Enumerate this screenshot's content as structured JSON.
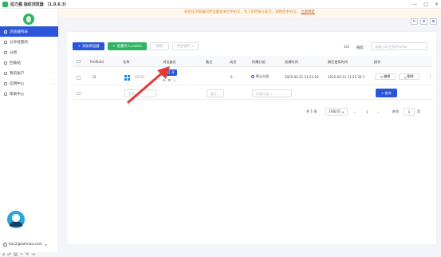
{
  "app": {
    "title": "拉力猫 指纹浏览器 （1.0.6.3）",
    "brand_name": "拉力猫"
  },
  "window_controls": [
    "—",
    "□",
    "✕"
  ],
  "notice": {
    "text": "初始化浏览器同步设置会清空手机号，为了您的账号安全，请绑定手机号。",
    "link": "立即绑定"
  },
  "top_icons": [
    {
      "icon": "refresh-icon",
      "glyph": "↻"
    },
    {
      "icon": "settings-icon",
      "glyph": "⚙"
    },
    {
      "icon": "expand-icon",
      "glyph": "⊞"
    }
  ],
  "sidebar": {
    "items": [
      {
        "label": "浏览器列表",
        "icon": "list-icon",
        "active": true
      },
      {
        "label": "分享给我的",
        "icon": "share-icon"
      },
      {
        "label": "分组",
        "icon": "group-icon"
      },
      {
        "label": "回收站",
        "icon": "trash-icon"
      },
      {
        "label": "我的账户",
        "icon": "account-icon",
        "arrow": "›"
      },
      {
        "label": "应用中心",
        "icon": "apps-icon",
        "arrow": "›"
      },
      {
        "label": "帮助中心",
        "icon": "help-icon"
      }
    ],
    "account": "lion2@lalimao.com",
    "footer_icons": [
      "home-icon",
      "link-icon",
      "doc-icon",
      "star-icon",
      "chat-icon",
      "exit-icon"
    ]
  },
  "toolbar": {
    "add_label": "添加浏览器",
    "import_label": "批量导入cookie",
    "delete_label": "删除",
    "batch_label": "更多操作 ∨",
    "page_info": "1/1",
    "search_label": "搜索:",
    "search_placeholder": "请输入ID/名称/Profiles"
  },
  "table": {
    "headers": [
      "ProfileId",
      "名称",
      "浏览器名",
      "备注",
      "成员",
      "所属分组",
      "创建时间",
      "最后使用时间",
      "操作"
    ],
    "rows": [
      {
        "os": "windows",
        "name": "00151",
        "open_label": "打 开",
        "note": "",
        "members": "0",
        "group": "默认分组",
        "created": "2025-02-21 11:21:29",
        "last_used": "2025-02-21 11:21:39 1",
        "edit_label": "编辑",
        "delete_label": "删除"
      }
    ],
    "filter": {
      "name_placeholder": "名称",
      "note_placeholder": "备注",
      "group_placeholder": "所属分组 ∨",
      "query_label": "查询"
    }
  },
  "pagination": {
    "total": "共 1 条",
    "page_size": "10条/页",
    "current": "1",
    "goto_label": "前往",
    "goto_value": "1",
    "page_unit": "页"
  },
  "colors": {
    "primary": "#2b56d9",
    "green": "#2fb463",
    "notice": "#e6892a",
    "arrow": "#e53935"
  }
}
